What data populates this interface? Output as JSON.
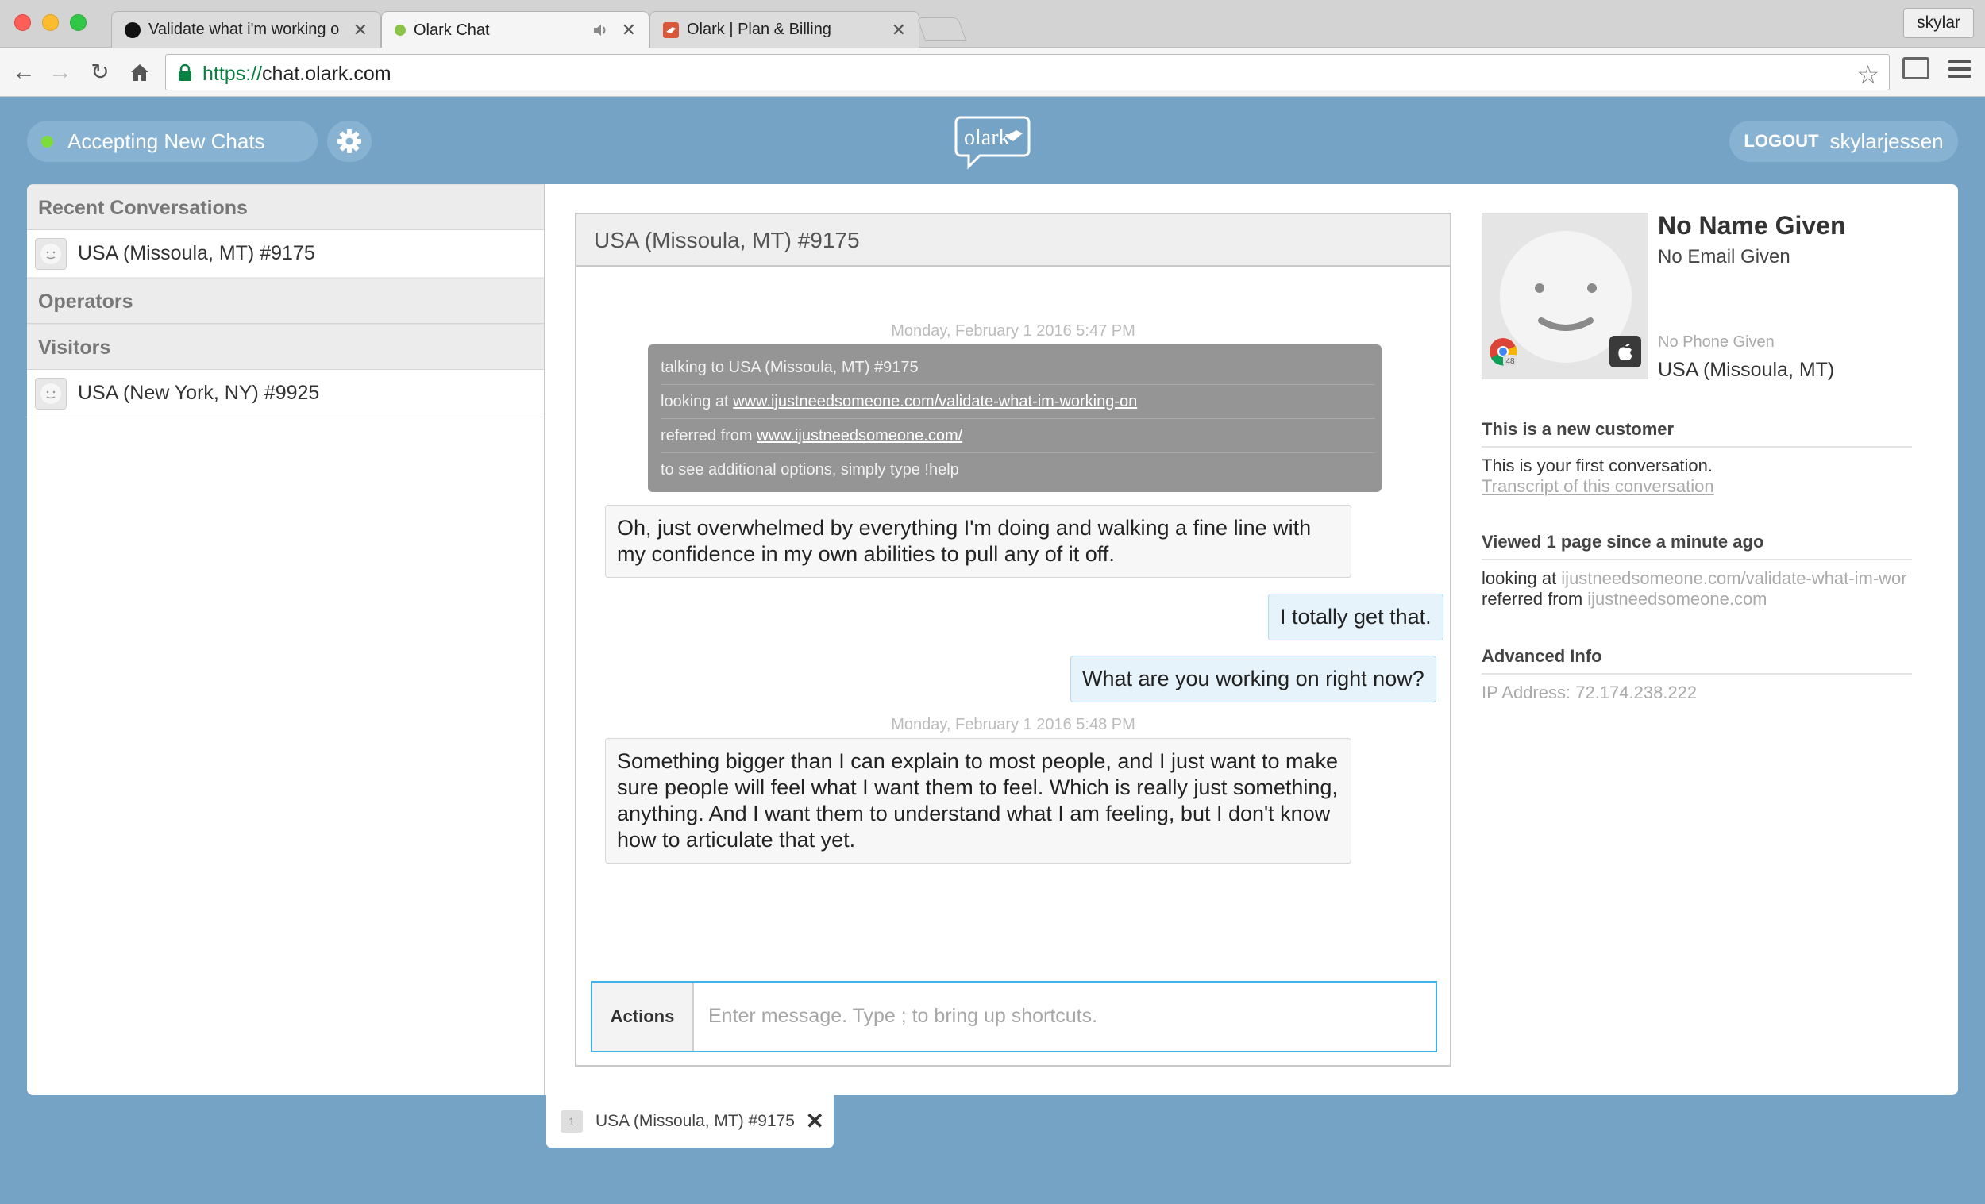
{
  "browser": {
    "tabs": [
      {
        "title": "Validate what i'm working o",
        "close": "✕"
      },
      {
        "title": "Olark Chat",
        "close": "✕"
      },
      {
        "title": "Olark | Plan & Billing",
        "close": "✕"
      }
    ],
    "profile": "skylar",
    "url_scheme": "https://",
    "url_host": "chat.olark.com"
  },
  "header": {
    "status": "Accepting New Chats",
    "logout": "LOGOUT",
    "username": "skylarjessen",
    "logo_text": "olark"
  },
  "sidebar": {
    "recent_title": "Recent Conversations",
    "recent": [
      {
        "label": "USA (Missoula, MT) #9175"
      }
    ],
    "operators_title": "Operators",
    "visitors_title": "Visitors",
    "visitors": [
      {
        "label": "USA (New York, NY) #9925"
      }
    ]
  },
  "chat": {
    "title": "USA (Missoula, MT) #9175",
    "timestamp1": "Monday, February 1 2016 5:47 PM",
    "system": {
      "talking_to": "talking to USA (Missoula, MT) #9175",
      "looking_prefix": "looking at ",
      "looking_url": "www.ijustneedsomeone.com/validate-what-im-working-on",
      "referred_prefix": "referred from ",
      "referred_url": "www.ijustneedsomeone.com/",
      "help": "to see additional options, simply type !help"
    },
    "messages": [
      {
        "from": "visitor",
        "text": "Oh, just overwhelmed by everything I'm doing and walking a fine line with my confidence in my own abilities to pull any of it off."
      },
      {
        "from": "operator",
        "text": "I totally get that."
      },
      {
        "from": "operator",
        "text": "What are you working on right now?"
      },
      {
        "from": "visitor",
        "text": "Something bigger than I can explain to most people, and I just want to make sure people will feel what I want them to feel. Which is really just something, anything. And I want them to understand what I am feeling, but I don't know how to articulate that yet."
      }
    ],
    "timestamp2": "Monday, February 1 2016 5:48 PM",
    "actions_label": "Actions",
    "input_placeholder": "Enter message. Type ; to bring up shortcuts."
  },
  "visitor_info": {
    "name": "No Name Given",
    "email": "No Email Given",
    "phone": "No Phone Given",
    "location": "USA (Missoula, MT)",
    "browser_version": "48",
    "customer_title": "This is a new customer",
    "first_convo": "This is your first conversation.",
    "transcript_link": "Transcript of this conversation",
    "viewed_title": "Viewed 1 page since a minute ago",
    "looking_prefix": "looking at ",
    "looking_url": "ijustneedsomeone.com/validate-what-im-wor",
    "referred_prefix": "referred from ",
    "referred_url": "ijustneedsomeone.com",
    "advanced_title": "Advanced Info",
    "ip": "IP Address: 72.174.238.222"
  },
  "bottom_tab": {
    "number": "1",
    "label": "USA (Missoula, MT) #9175",
    "close": "✕"
  },
  "colors": {
    "background": "#75a3c5",
    "pill": "#88b2d2",
    "status_green": "#7cdd3a",
    "input_focus": "#3db4e6",
    "system_box": "#959595"
  }
}
